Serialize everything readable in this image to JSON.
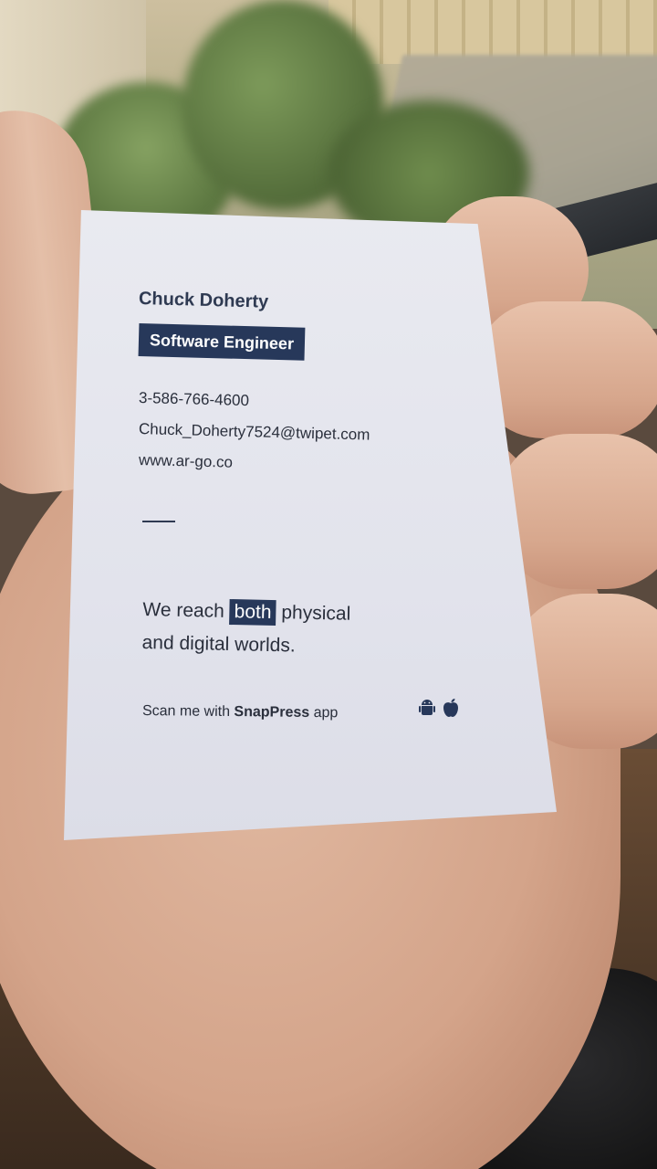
{
  "card": {
    "name": "Chuck Doherty",
    "title": "Software Engineer",
    "phone": "3-586-766-4600",
    "email": "Chuck_Doherty7524@twipet.com",
    "website": "www.ar-go.co",
    "tagline": {
      "part1": "We reach ",
      "highlight": "both",
      "part2": " physical",
      "line2": "and digital worlds."
    },
    "scan": {
      "prefix": "Scan me with ",
      "app": "SnapPress",
      "suffix": " app"
    },
    "icons": [
      "android-icon",
      "apple-icon"
    ],
    "colors": {
      "accent": "#27385a",
      "text": "#2a2f3c",
      "paper": "#e6e7ee"
    }
  }
}
